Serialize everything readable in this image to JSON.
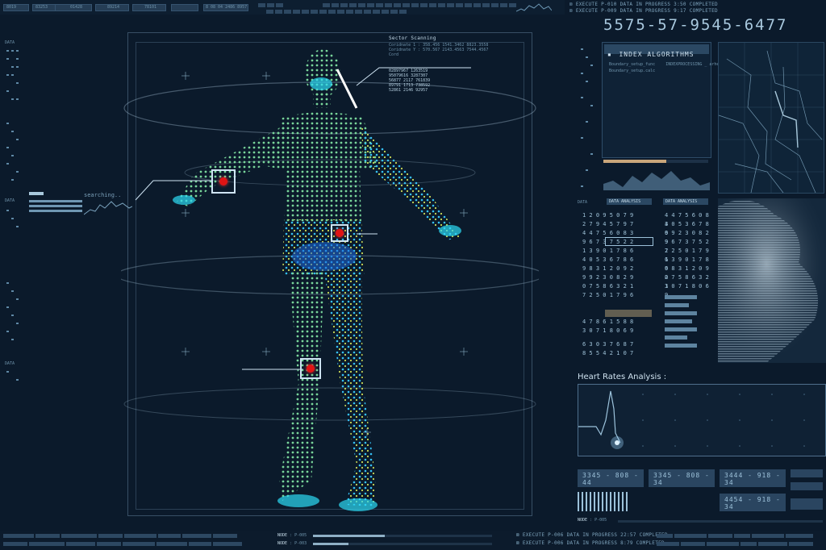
{
  "top_bar": {
    "chips": [
      "8019",
      "83253",
      "01428",
      "89214",
      "78101",
      "8 08 04 2486 8957"
    ],
    "right_lines": [
      {
        "label": "EXECUTE",
        "code": "P-010",
        "status": "DATA IN PROGRESS",
        "value": "3:50",
        "result": "COMPLETED"
      },
      {
        "label": "EXECUTE",
        "code": "P-009",
        "status": "DATA IN PROGRESS",
        "value": "9:17",
        "result": "COMPLETED"
      }
    ]
  },
  "scan": {
    "title": "Sector Scanning",
    "coord1_label": "Coridnate 1 :",
    "coord1_value": "358.456  1541.3462  8823.3558",
    "coord2_label": "Coridnate Y :",
    "coord2_value": "570.567  2143.4563  7544.4567",
    "coord3_label": "Cord",
    "numbers": [
      "02897967 1263519",
      "95079616 3287307",
      "56877 2117 761839",
      "89791 1713 738592",
      "52861 2146 92957"
    ],
    "searching_label": "searching.."
  },
  "side_codes": [
    "DATA",
    "DATA",
    "DATA"
  ],
  "right": {
    "big_number": "5575-57-9545-6477",
    "index_title": "INDEX ALGORITHMS",
    "index_lines": [
      "Boundary_setup_func",
      "Boundary_setup.calc",
      "INDEXPROCESSING _ arhead_id = 97"
    ],
    "data_label": "DATA",
    "data_analysis_1": "DATA ANALYSIS",
    "data_analysis_2": "DATA ANALYSIS",
    "num_rows": [
      "1 2 0 9 5 0 7 9",
      "2 7 9 4 5 7 9 7",
      "4 4 7 5 6 0 8 3",
      "9 6 7 3 7 5 2 2",
      "1 3 9 0 1 7 8 6",
      "4 0 5 3 6 7 8 6",
      "9 8 3 1 2 0 9 2",
      "9 9 2 3 0 8 2 9",
      "0 7 5 8 6 3 2 1",
      "7 2 5 0 1 7 9 6",
      "4 7 8 6 1 5 8 8",
      "3 0 7 1 8 0 6 9",
      "6 3 0 3 7 6 8 7",
      "8 5 5 4 2 1 0 7"
    ],
    "heart_title": "Heart Rates Analysis :",
    "boxes": [
      "3345 - 808 - 44",
      "3345 - 808 - 34",
      "3444 - 918 - 34",
      "4454 - 918 - 34"
    ],
    "node_label": "NODE",
    "node_code": "P-005"
  },
  "bottom": {
    "node1_label": "NODE",
    "node1_code": "P-005",
    "node2_label": "NODE",
    "node2_code": "P-003",
    "exec1": {
      "label": "EXECUTE",
      "code": "P-006",
      "status": "DATA IN PROGRESS",
      "value": "22:57",
      "result": "COMPLETED"
    },
    "exec2": {
      "label": "EXECUTE",
      "code": "P-006",
      "status": "DATA IN PROGRESS",
      "value": "8:79",
      "result": "COMPLETED"
    }
  }
}
